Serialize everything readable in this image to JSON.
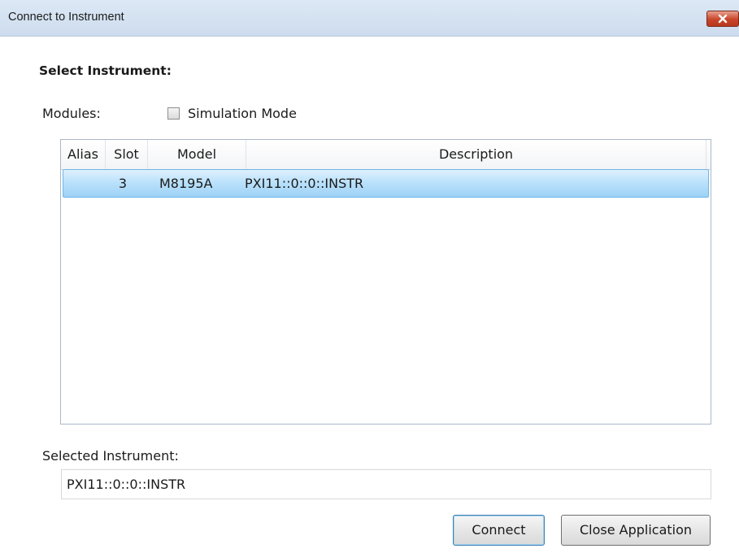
{
  "window": {
    "title": "Connect to Instrument",
    "accent_color": "#cddcee",
    "close_icon": "close-x-icon"
  },
  "form": {
    "heading": "Select Instrument:",
    "modules_label": "Modules:",
    "simulation_mode": {
      "label": "Simulation Mode",
      "checked": false
    }
  },
  "instrument_list": {
    "columns": [
      "Alias",
      "Slot",
      "Model",
      "Description"
    ],
    "rows": [
      {
        "alias": "",
        "slot": "3",
        "model": "M8195A",
        "description": "PXI11::0::0::INSTR",
        "selected": true
      }
    ],
    "selection_color": "#b8e0fb"
  },
  "selected_instrument": {
    "label": "Selected Instrument:",
    "value": "PXI11::0::0::INSTR"
  },
  "buttons": {
    "connect": "Connect",
    "close_application": "Close Application"
  }
}
